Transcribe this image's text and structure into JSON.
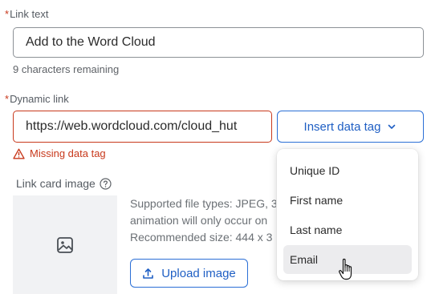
{
  "link_text": {
    "label": "Link text",
    "value": "Add to the Word Cloud",
    "helper": "9 characters remaining"
  },
  "dynamic_link": {
    "label": "Dynamic link",
    "value": "https://web.wordcloud.com/cloud_hut",
    "error": "Missing data tag",
    "insert_button": "Insert data tag"
  },
  "data_tag_menu": {
    "items": [
      "Unique ID",
      "First name",
      "Last name",
      "Email"
    ],
    "hovered": "Email"
  },
  "link_card_image": {
    "label": "Link card image",
    "supported_types_line": "Supported file types: JPEG, 3",
    "animation_line": "animation will only occur on",
    "recommended_line": "Recommended size: 444 x 3",
    "upload_button": "Upload image"
  },
  "colors": {
    "accent": "#1f5fc4",
    "error": "#c8391c"
  },
  "icons": [
    "warning-icon",
    "help-circle-icon",
    "chevron-down-icon",
    "image-icon",
    "upload-icon",
    "hand-pointer-icon"
  ]
}
